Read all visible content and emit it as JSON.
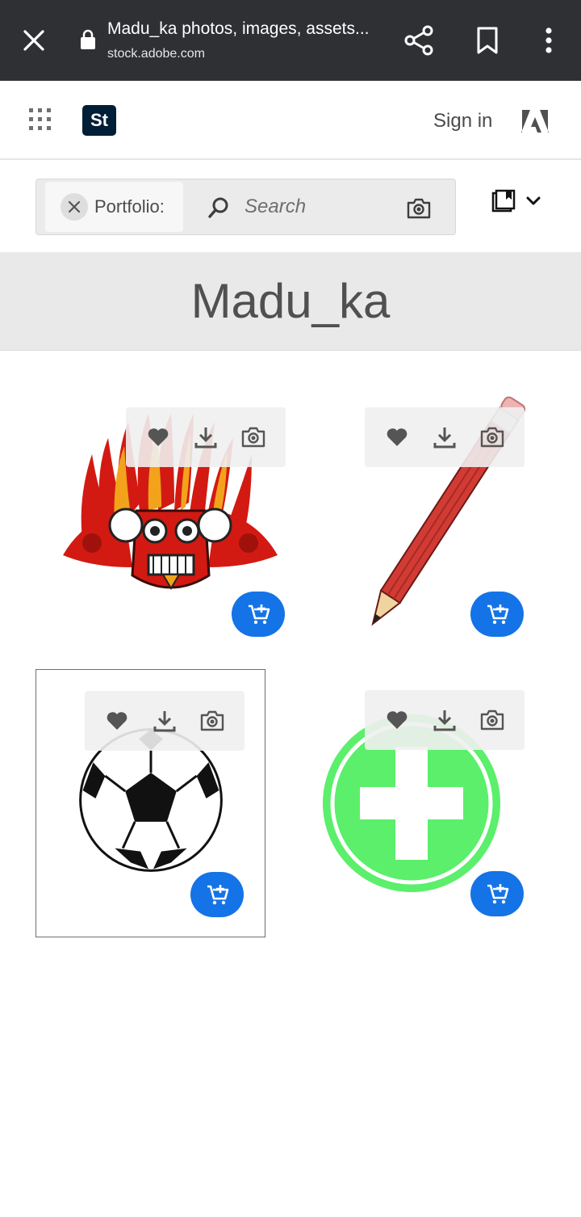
{
  "browser": {
    "page_title": "Madu_ka photos, images, assets...",
    "url": "stock.adobe.com",
    "icons": [
      "close-icon",
      "lock-icon",
      "share-icon",
      "bookmark-icon",
      "more-icon"
    ]
  },
  "header": {
    "product_logo_text": "St",
    "sign_in_label": "Sign in",
    "icons": [
      "apps-grid-icon",
      "adobe-logo-icon"
    ]
  },
  "search": {
    "filter_chip_label": "Portfolio:",
    "placeholder": "Search",
    "icons": [
      "clear-filter-icon",
      "search-icon",
      "camera-icon",
      "collections-icon",
      "chevron-down-icon"
    ]
  },
  "portfolio": {
    "title": "Madu_ka"
  },
  "assets": [
    {
      "subject": "mask",
      "colors": {
        "primary": "#d21a12",
        "accent": "#f2a31b"
      }
    },
    {
      "subject": "pencil",
      "colors": {
        "primary": "#d23b34",
        "accent": "#f0d4a0"
      }
    },
    {
      "subject": "soccer-ball",
      "colors": {
        "primary": "#000000",
        "accent": "#ffffff"
      }
    },
    {
      "subject": "plus-circle",
      "colors": {
        "primary": "#5bef6b",
        "accent": "#ffffff"
      }
    }
  ],
  "asset_actions": {
    "icons": [
      "heart-icon",
      "download-icon",
      "camera-icon",
      "add-to-cart-icon"
    ],
    "cart_color": "#1473e6"
  }
}
